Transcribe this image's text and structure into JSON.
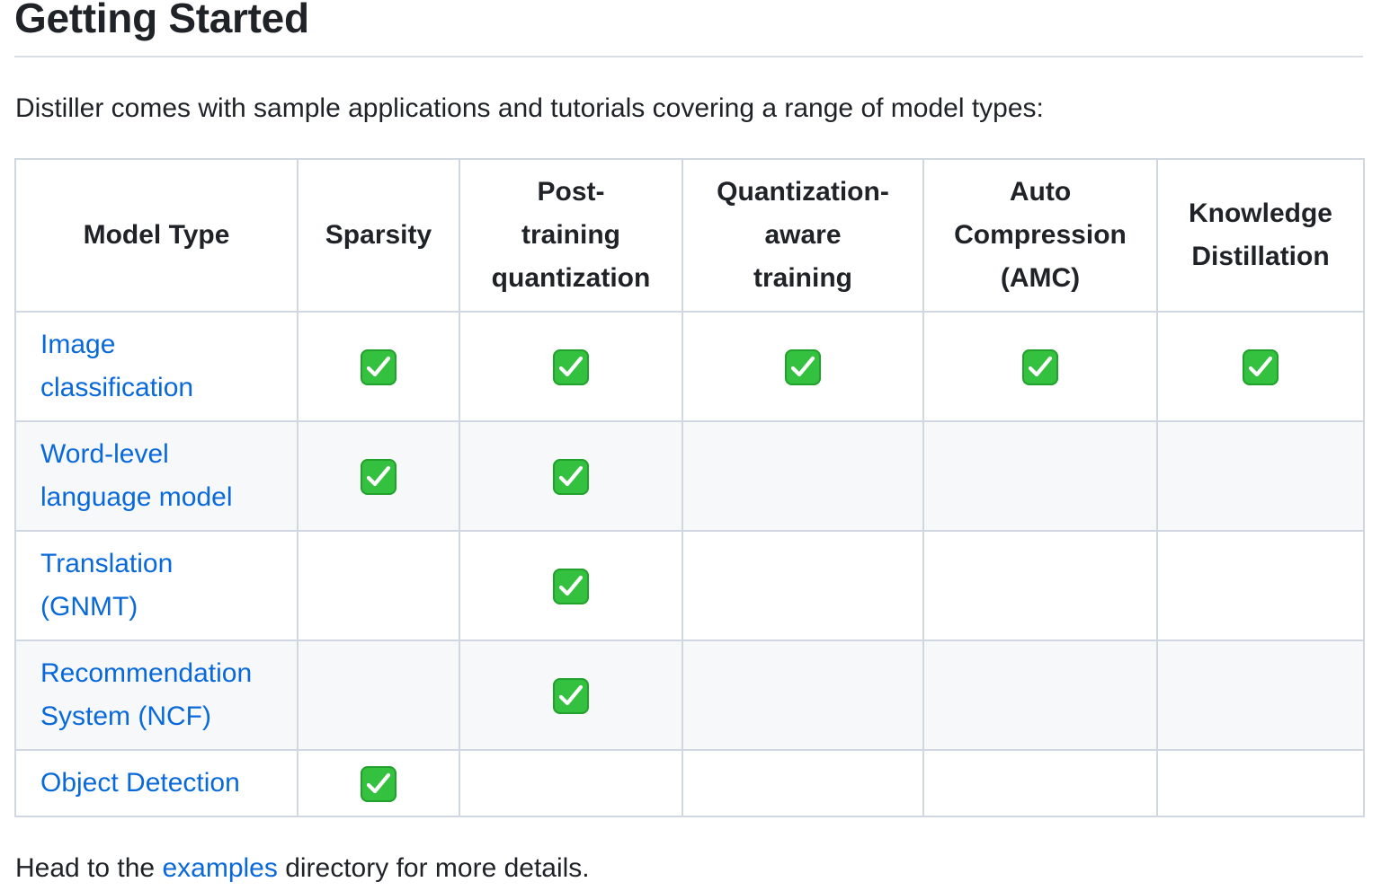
{
  "heading": "Getting Started",
  "intro": "Distiller comes with sample applications and tutorials covering a range of model types:",
  "table": {
    "headers": {
      "model_type": "Model Type",
      "sparsity": "Sparsity",
      "ptq_line1": "Post-",
      "ptq_line2": "training",
      "ptq_line3": "quantization",
      "qat_line1": "Quantization-",
      "qat_line2": "aware",
      "qat_line3": "training",
      "amc_line1": "Auto",
      "amc_line2": "Compression",
      "amc_line3": "(AMC)",
      "kd_line1": "Knowledge",
      "kd_line2": "Distillation"
    },
    "rows": [
      {
        "line1": "Image",
        "line2": "classification",
        "sparsity": true,
        "ptq": true,
        "qat": true,
        "amc": true,
        "kd": true
      },
      {
        "line1": "Word-level",
        "line2": "language model",
        "sparsity": true,
        "ptq": true,
        "qat": false,
        "amc": false,
        "kd": false
      },
      {
        "line1": "Translation",
        "line2": "(GNMT)",
        "sparsity": false,
        "ptq": true,
        "qat": false,
        "amc": false,
        "kd": false
      },
      {
        "line1": "Recommendation",
        "line2": "System (NCF)",
        "sparsity": false,
        "ptq": true,
        "qat": false,
        "amc": false,
        "kd": false
      },
      {
        "line1": "Object Detection",
        "line2": "",
        "sparsity": true,
        "ptq": false,
        "qat": false,
        "amc": false,
        "kd": false
      }
    ]
  },
  "footer": {
    "before": "Head to the ",
    "link": "examples",
    "after": " directory for more details."
  },
  "colors": {
    "link": "#0969da",
    "check_bg": "#34c13f",
    "border": "#d0d7de",
    "alt_row": "#f6f8fa"
  },
  "icons": {
    "check": "white-heavy-check-mark-icon"
  }
}
